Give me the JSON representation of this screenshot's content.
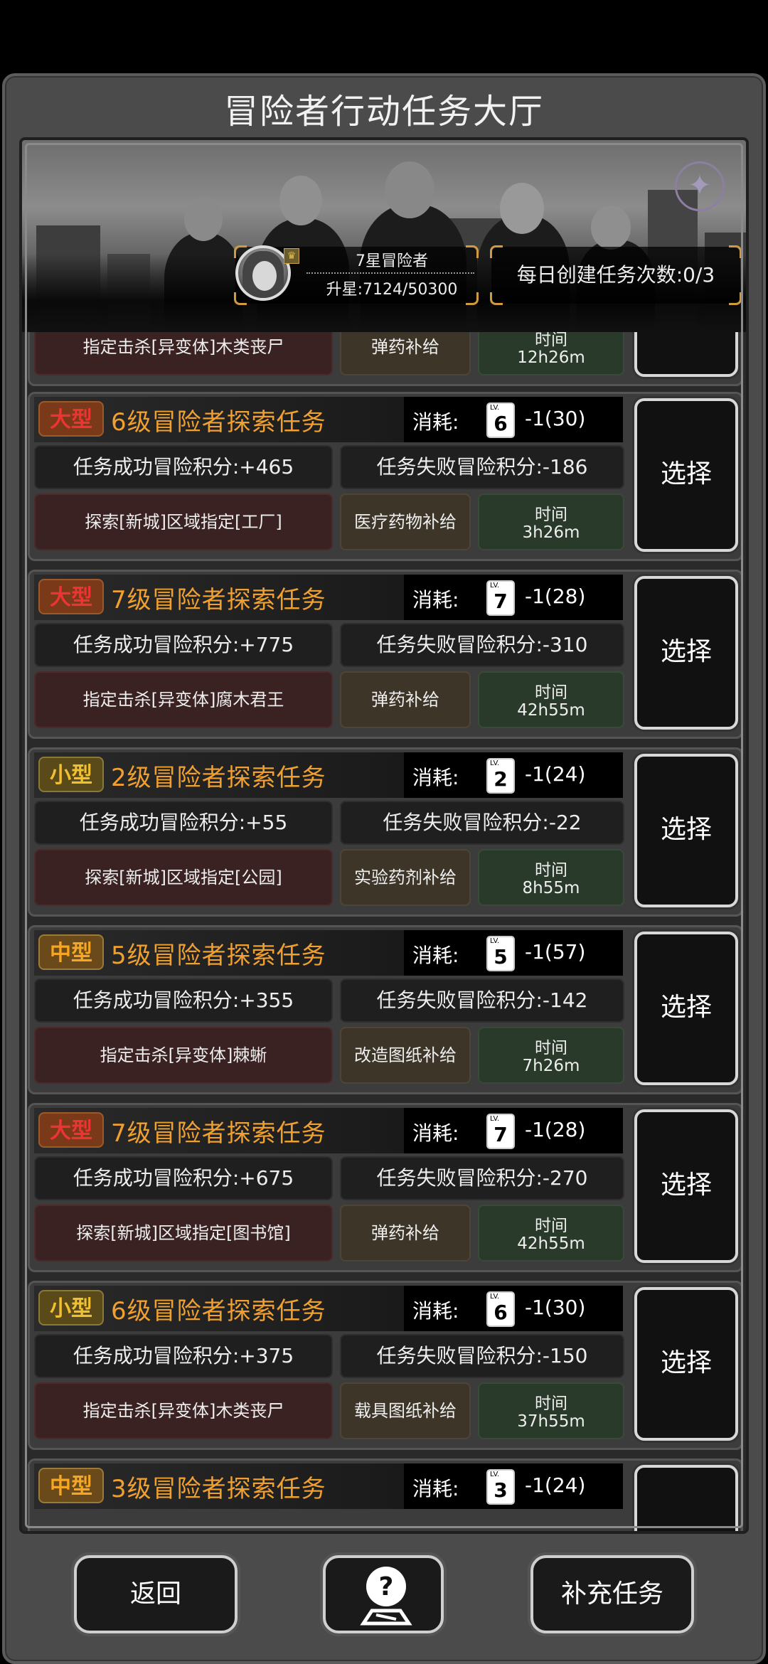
{
  "title": "冒险者行动任务大厅",
  "rank": {
    "name": "7星冒险者",
    "stars_progress": "升星:7124/50300"
  },
  "daily": {
    "label": "每日创建任务次数:0/3"
  },
  "partial_top": {
    "target": "指定击杀[异变体]木类丧尸",
    "supply": "弹药补给",
    "time_label": "时间",
    "time": "12h26m"
  },
  "tasks": [
    {
      "size": "大型",
      "title": "6级冒险者探索任务",
      "cost_label": "消耗:",
      "lv_label": "LV.",
      "lv": "6",
      "cost": "-1(30)",
      "success": "任务成功冒险积分:+465",
      "fail": "任务失败冒险积分:-186",
      "target": "探索[新城]区域指定[工厂]",
      "supply": "医疗药物补给",
      "time_label": "时间",
      "time": "3h26m",
      "select": "选择"
    },
    {
      "size": "大型",
      "title": "7级冒险者探索任务",
      "cost_label": "消耗:",
      "lv_label": "LV.",
      "lv": "7",
      "cost": "-1(28)",
      "success": "任务成功冒险积分:+775",
      "fail": "任务失败冒险积分:-310",
      "target": "指定击杀[异变体]腐木君王",
      "supply": "弹药补给",
      "time_label": "时间",
      "time": "42h55m",
      "select": "选择"
    },
    {
      "size": "小型",
      "title": "2级冒险者探索任务",
      "cost_label": "消耗:",
      "lv_label": "LV.",
      "lv": "2",
      "cost": "-1(24)",
      "success": "任务成功冒险积分:+55",
      "fail": "任务失败冒险积分:-22",
      "target": "探索[新城]区域指定[公园]",
      "supply": "实验药剂补给",
      "time_label": "时间",
      "time": "8h55m",
      "select": "选择"
    },
    {
      "size": "中型",
      "title": "5级冒险者探索任务",
      "cost_label": "消耗:",
      "lv_label": "LV.",
      "lv": "5",
      "cost": "-1(57)",
      "success": "任务成功冒险积分:+355",
      "fail": "任务失败冒险积分:-142",
      "target": "指定击杀[异变体]棘蜥",
      "supply": "改造图纸补给",
      "time_label": "时间",
      "time": "7h26m",
      "select": "选择"
    },
    {
      "size": "大型",
      "title": "7级冒险者探索任务",
      "cost_label": "消耗:",
      "lv_label": "LV.",
      "lv": "7",
      "cost": "-1(28)",
      "success": "任务成功冒险积分:+675",
      "fail": "任务失败冒险积分:-270",
      "target": "探索[新城]区域指定[图书馆]",
      "supply": "弹药补给",
      "time_label": "时间",
      "time": "42h55m",
      "select": "选择"
    },
    {
      "size": "小型",
      "title": "6级冒险者探索任务",
      "cost_label": "消耗:",
      "lv_label": "LV.",
      "lv": "6",
      "cost": "-1(30)",
      "success": "任务成功冒险积分:+375",
      "fail": "任务失败冒险积分:-150",
      "target": "指定击杀[异变体]木类丧尸",
      "supply": "载具图纸补给",
      "time_label": "时间",
      "time": "37h55m",
      "select": "选择"
    }
  ],
  "partial_bottom": {
    "size": "中型",
    "title": "3级冒险者探索任务",
    "cost_label": "消耗:",
    "lv_label": "LV.",
    "lv": "3",
    "cost": "-1(24)"
  },
  "buttons": {
    "back": "返回",
    "help_icon": "question-map-icon",
    "replenish": "补充任务"
  },
  "colors": {
    "title_orange": "#f0a030",
    "large_badge": "#e33333",
    "mid_badge": "#f5a623",
    "small_badge": "#f0c030",
    "gold_bracket": "#d29a3e"
  }
}
